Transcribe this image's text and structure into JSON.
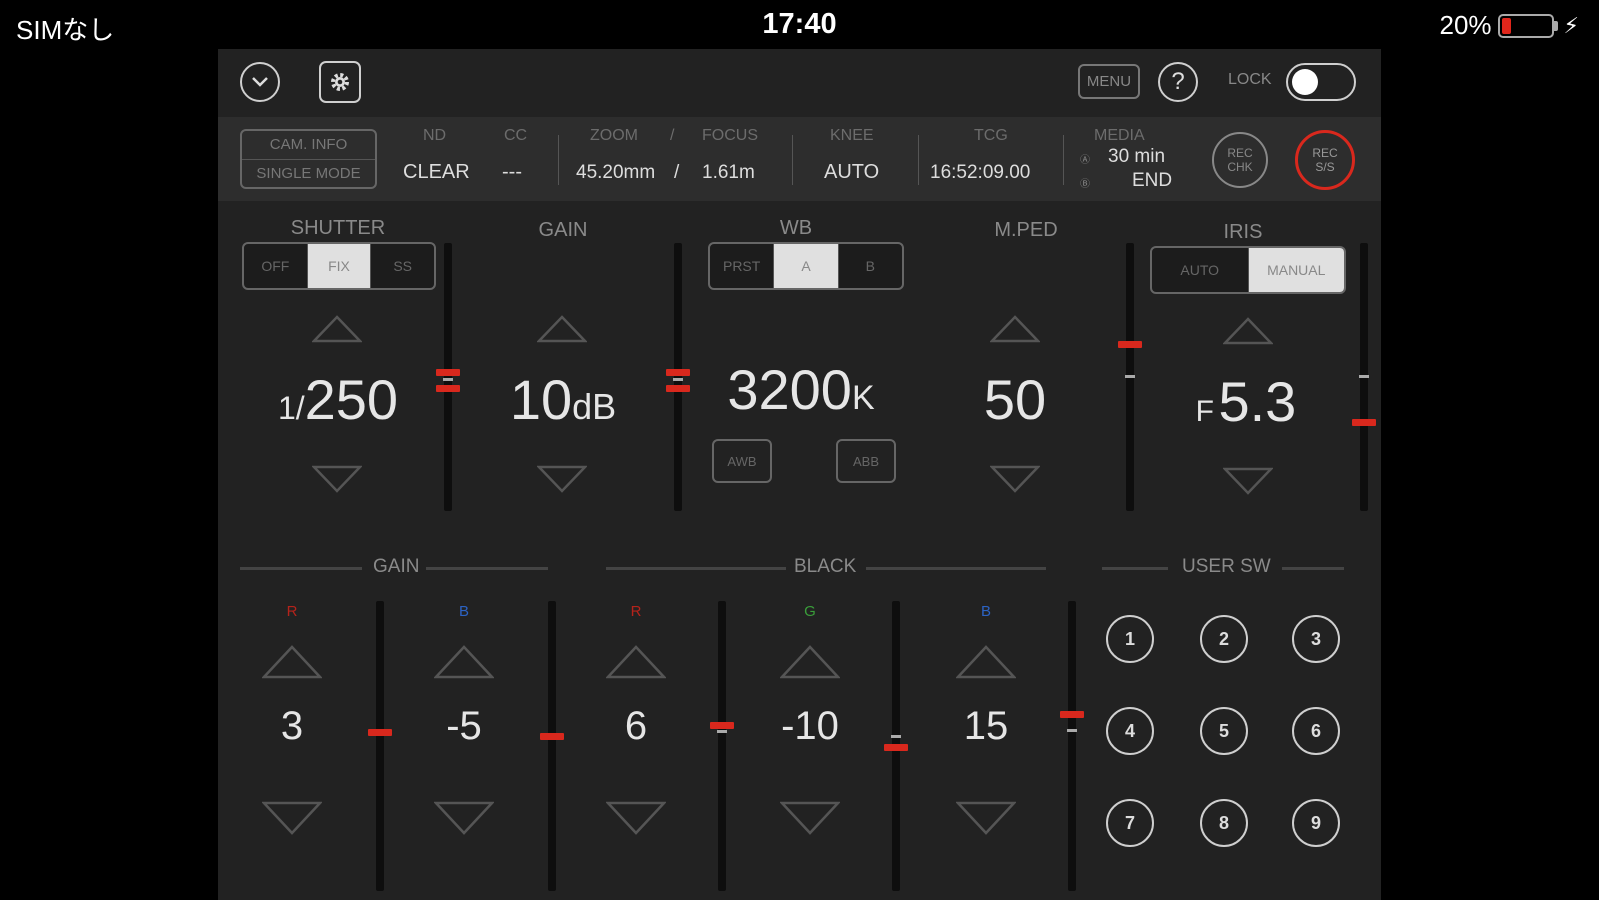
{
  "status_bar": {
    "carrier": "SIMなし",
    "time": "17:40",
    "battery": "20%"
  },
  "topbar": {
    "menu_label": "MENU",
    "lock_label": "LOCK"
  },
  "infobar": {
    "cam_info_line1": "CAM. INFO",
    "cam_info_line2": "SINGLE MODE",
    "nd_label": "ND",
    "nd_value": "CLEAR",
    "cc_label": "CC",
    "cc_value": "---",
    "zoom_label": "ZOOM",
    "slash1": "/",
    "focus_label": "FOCUS",
    "zoom_value": "45.20mm",
    "slash2": "/",
    "focus_value": "1.61m",
    "knee_label": "KNEE",
    "knee_value": "AUTO",
    "tcg_label": "TCG",
    "tcg_value": "16:52:09.00",
    "media_label": "MEDIA",
    "media_slot1": "30 min",
    "media_slot2": "END",
    "rec_chk": [
      "REC",
      "CHK"
    ],
    "rec_ss": [
      "REC",
      "S/S"
    ]
  },
  "shutter": {
    "title": "SHUTTER",
    "modes": [
      "OFF",
      "FIX",
      "SS"
    ],
    "prefix": "1/",
    "value": "250"
  },
  "gain": {
    "title": "GAIN",
    "value": "10",
    "unit": "dB"
  },
  "wb": {
    "title": "WB",
    "modes": [
      "PRST",
      "A",
      "B"
    ],
    "value": "3200",
    "unit": "K",
    "awb": "AWB",
    "abb": "ABB"
  },
  "mped": {
    "title": "M.PED",
    "value": "50"
  },
  "iris": {
    "title": "IRIS",
    "modes": [
      "AUTO",
      "MANUAL"
    ],
    "prefix": "F",
    "value": "5.3"
  },
  "gain_section": {
    "title": "GAIN",
    "r_label": "R",
    "b_label": "B",
    "r_value": "3",
    "b_value": "-5"
  },
  "black_section": {
    "title": "BLACK",
    "r_label": "R",
    "g_label": "G",
    "b_label": "B",
    "r_value": "6",
    "g_value": "-10",
    "b_value": "15"
  },
  "user_sw": {
    "title": "USER SW",
    "buttons": [
      "1",
      "2",
      "3",
      "4",
      "5",
      "6",
      "7",
      "8",
      "9"
    ]
  },
  "colors": {
    "accent_red": "#d9281d",
    "bg": "#222222",
    "r": "#b5231b",
    "g": "#3a9e3a",
    "b": "#2c63c4"
  }
}
